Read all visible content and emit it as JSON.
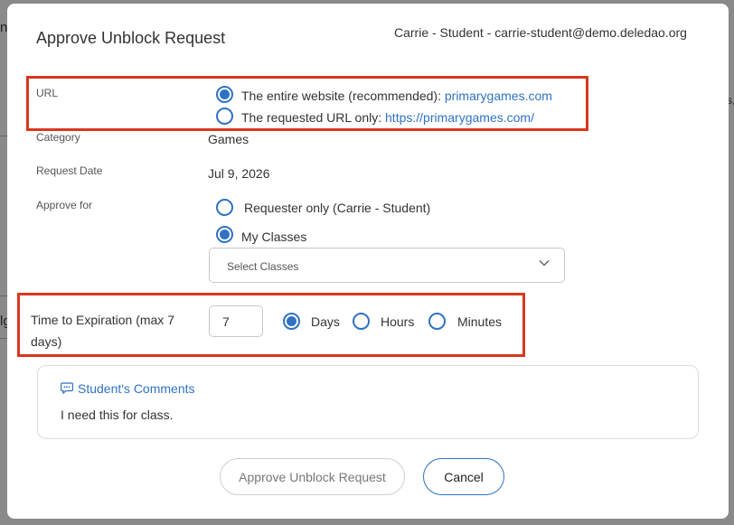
{
  "background": {
    "frag_1": "n",
    "frag_2": "lg",
    "frag_3": "s,"
  },
  "modal": {
    "title": "Approve Unblock Request",
    "user_info": "Carrie - Student - carrie-student@demo.deledao.org"
  },
  "url_section": {
    "label": "URL",
    "option_entire_prefix": "The entire website (recommended): ",
    "option_entire_link": "primarygames.com",
    "option_requested_prefix": "The requested URL only: ",
    "option_requested_link": "https://primarygames.com/",
    "selected": "entire"
  },
  "category": {
    "label": "Category",
    "value": "Games"
  },
  "request_date": {
    "label": "Request Date",
    "value": "Jul 9, 2026"
  },
  "approve_for": {
    "label": "Approve for",
    "option_requester": "Requester only (Carrie - Student)",
    "option_classes": "My Classes",
    "selected": "classes",
    "select_placeholder": "Select Classes"
  },
  "expiration": {
    "label": "Time to Expiration (max 7 days)",
    "value": "7",
    "unit_days": "Days",
    "unit_hours": "Hours",
    "unit_minutes": "Minutes",
    "selected_unit": "days"
  },
  "comments": {
    "heading": "Student's Comments",
    "text": "I need this for class."
  },
  "buttons": {
    "approve": "Approve Unblock Request",
    "cancel": "Cancel"
  },
  "colors": {
    "accent": "#2f72c4",
    "highlight": "#d9381e"
  },
  "icons": {
    "comment": "speech-bubble-icon",
    "dropdown": "chevron-down-icon"
  }
}
